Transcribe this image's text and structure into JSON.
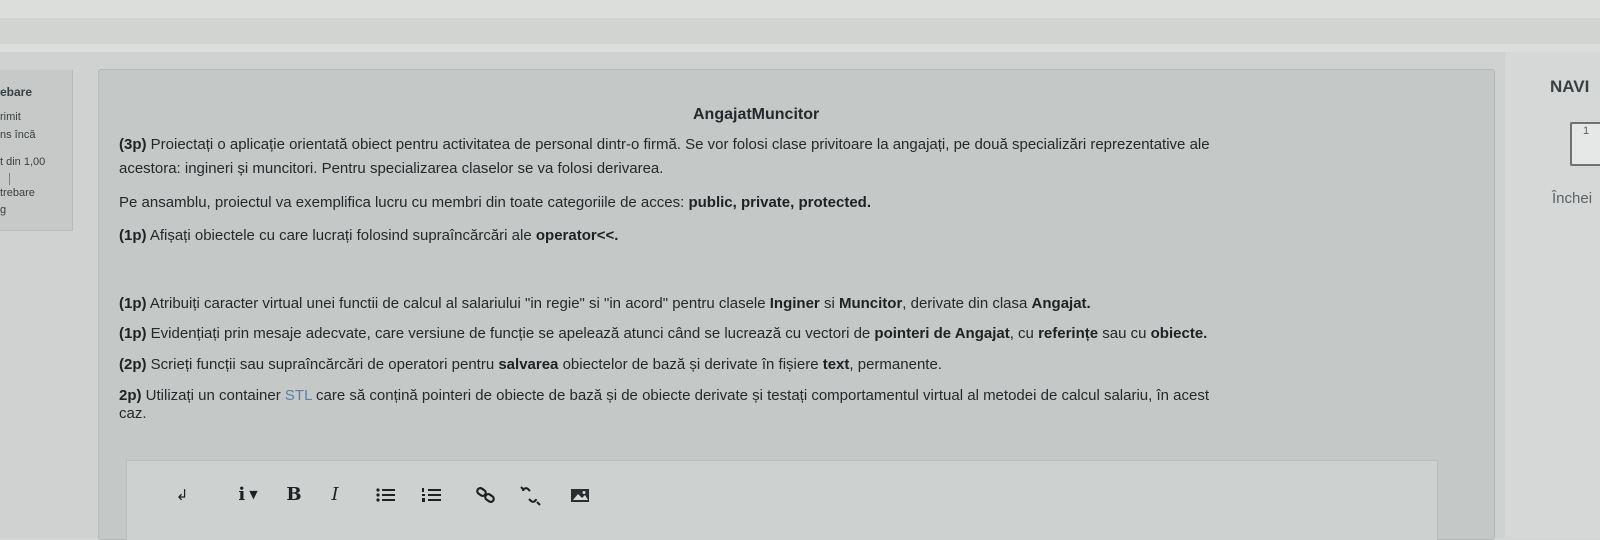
{
  "left_info": {
    "line1": "ebare",
    "line2": "rimit",
    "line3": "ns încă",
    "line4": "t din 1,00",
    "line5": "trebare",
    "line6": "g"
  },
  "question": {
    "title": "AngajatMuncitor",
    "p1": {
      "pts": "(3p)",
      "line1": " Proiectați o aplicație orientată obiect pentru activitatea de personal dintr-o firmă. Se vor folosi clase privitoare la angajați, pe două specializări reprezentative ale",
      "line2": "acestora: ingineri și muncitori. Pentru specializarea claselor se va folosi derivarea."
    },
    "p2": {
      "text": "Pe ansamblu, proiectul va exemplifica lucru cu membri din toate categoriile de acces: ",
      "bold": "public, private,  protected."
    },
    "p3": {
      "pts": "(1p)",
      "text": " Afișați obiectele cu care lucrați folosind supraîncărcări ale ",
      "bold": "operator<<."
    },
    "p4": {
      "pts": "(1p)",
      "text1": " Atribuiți caracter virtual unei functii de calcul al salariului \"in regie\" si \"in acord\" pentru clasele ",
      "b1": "Inginer",
      "text2": " si ",
      "b2": "Muncitor",
      "text3": ",  derivate din clasa ",
      "b3": "Angajat."
    },
    "p5": {
      "pts": "(1p)",
      "text1": " Evidențiați prin mesaje adecvate, care versiune de funcție se apelează atunci când se lucrează cu vectori de ",
      "b1": "pointeri de Angajat",
      "text2": ", cu ",
      "b2": "referințe",
      "text3": " sau cu ",
      "b3": "obiecte."
    },
    "p6": {
      "pts": "(2p)",
      "text1": " Scrieți funcții sau supraîncărcări de operatori pentru ",
      "b1": "salvarea",
      "text2": " obiectelor de bază și derivate în  fișiere ",
      "b2": "text",
      "text3": ", permanente."
    },
    "p7": {
      "pts": "2p)",
      "text1": " Utilizați un container ",
      "stl": "STL",
      "text2": " care să conțină pointeri de obiecte de bază și de obiecte derivate și testați comportamentul virtual al metodei de calcul salariu, în acest",
      "line2": "caz."
    }
  },
  "toolbar": {
    "paragraph_label": "↲",
    "info_label": "i",
    "bold_label": "B",
    "italic_label": "I"
  },
  "navigation": {
    "title": "NAVI",
    "question_number": "1",
    "finish_label": "Închei"
  }
}
